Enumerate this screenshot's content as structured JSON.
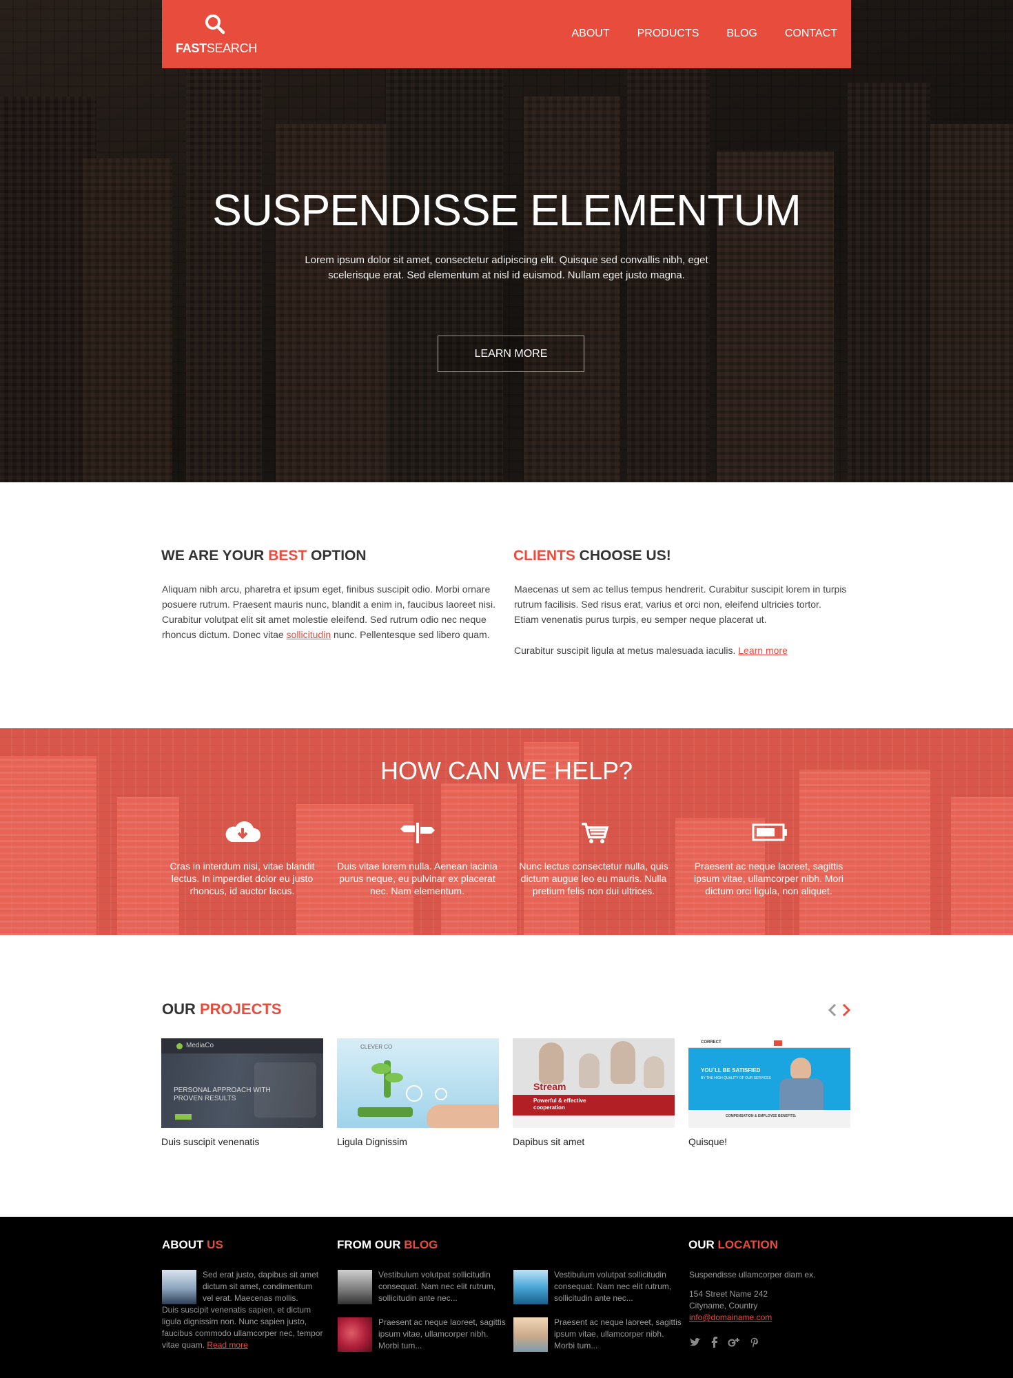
{
  "brand": {
    "logo_bold": "FAST",
    "logo_light": "SEARCH",
    "accent_color": "#e84c3d"
  },
  "nav": {
    "items": [
      "ABOUT",
      "PRODUCTS",
      "BLOG",
      "CONTACT"
    ]
  },
  "hero": {
    "title": "SUSPENDISSE ELEMENTUM",
    "text": "Lorem ipsum dolor sit amet, consectetur adipiscing elit. Quisque sed convallis nibh, eget scelerisque erat. Sed elementum at nisl id euismod. Nullam eget justo magna.",
    "button": "LEARN MORE"
  },
  "intro": {
    "left": {
      "title_a": "WE ARE YOUR ",
      "title_b": "BEST",
      "title_c": " OPTION",
      "text_a": "Aliquam nibh arcu, pharetra et ipsum eget, finibus suscipit odio. Morbi ornare posuere rutrum. Praesent mauris nunc, blandit a enim in, faucibus laoreet nisi. Curabitur volutpat elit sit amet molestie eleifend. Sed rutrum odio nec neque rhoncus dictum. Donec vitae ",
      "link": "sollicitudin",
      "text_b": " nunc. Pellentesque sed libero quam."
    },
    "right": {
      "title_a": "CLIENTS",
      "title_b": " CHOOSE US!",
      "text": "Maecenas ut sem ac tellus tempus hendrerit. Curabitur suscipit lorem in turpis rutrum facilisis. Sed risus erat, varius et orci non, eleifend ultricies tortor. Etiam venenatis purus turpis, eu semper neque placerat ut.",
      "text2": "Curabitur suscipit ligula at metus malesuada iaculis. ",
      "link": "Learn more"
    }
  },
  "help": {
    "title": "HOW CAN WE HELP?",
    "items": [
      {
        "icon": "cloud-download-icon",
        "text": "Cras in interdum nisi, vitae blandit lectus. In imperdiet dolor eu justo rhoncus, id auctor lacus."
      },
      {
        "icon": "signpost-icon",
        "text": "Duis vitae lorem nulla. Aenean lacinia purus neque, eu pulvinar ex placerat nec. Nam elementum."
      },
      {
        "icon": "cart-icon",
        "text": "Nunc lectus consectetur nulla, quis dictum augue leo eu mauris. Nulla pretium felis non dui ultrices."
      },
      {
        "icon": "battery-icon",
        "text": "Praesent ac neque laoreet, sagittis ipsum vitae, ullamcorper nibh. Mori dictum orci ligula, non aliquet."
      }
    ]
  },
  "projects": {
    "title_a": "OUR ",
    "title_b": "PROJECTS",
    "items": [
      {
        "caption": "Duis suscipit venenatis",
        "shot_brand": "MediaCo",
        "shot_line1": "PERSONAL APPROACH WITH",
        "shot_line2": "PROVEN RESULTS"
      },
      {
        "caption": "Ligula Dignissim",
        "shot_brand": "CLEVER CO"
      },
      {
        "caption": "Dapibus sit amet",
        "shot_brand": "Stream",
        "shot_line1": "Powerful & effective",
        "shot_line2": "cooperation"
      },
      {
        "caption": "Quisque!",
        "shot_brand": "CORRECT",
        "shot_line1": "YOU`LL BE SATISFIED",
        "shot_line2": "BY THE HIGH QUALITY OF OUR SERVICES",
        "shot_line3": "COMPENSATION & EMPLOYEE BENEFITS:"
      }
    ]
  },
  "footer": {
    "about": {
      "title_a": "ABOUT ",
      "title_b": "US",
      "text1": "Sed erat justo, dapibus sit amet dictum sit amet, condimentum vel erat. Maecenas mollis.",
      "text2": "Duis suscipit venenatis sapien, et dictum ligula dignissim non. Nunc sapien justo, faucibus commodo ullamcorper nec, tempor vitae quam. ",
      "link": "Read more"
    },
    "blog": {
      "title_a": "FROM OUR ",
      "title_b": "BLOG",
      "posts": [
        "Vestibulum volutpat sollicitudin consequat. Nam nec elit rutrum, sollicitudin ante nec...",
        "Vestibulum volutpat sollicitudin consequat. Nam nec elit rutrum, sollicitudin ante nec...",
        "Praesent ac neque laoreet, sagittis ipsum vitae, ullamcorper nibh. Morbi tum...",
        "Praesent ac neque laoreet, sagittis ipsum vitae, ullamcorper nibh. Morbi tum..."
      ]
    },
    "location": {
      "title_a": "OUR ",
      "title_b": "LOCATION",
      "line1": "Suspendisse ullamcorper diam ex.",
      "addr1": "154 Street Name 242",
      "addr2": "Cityname, Country",
      "email": "info@domainame.com"
    }
  }
}
